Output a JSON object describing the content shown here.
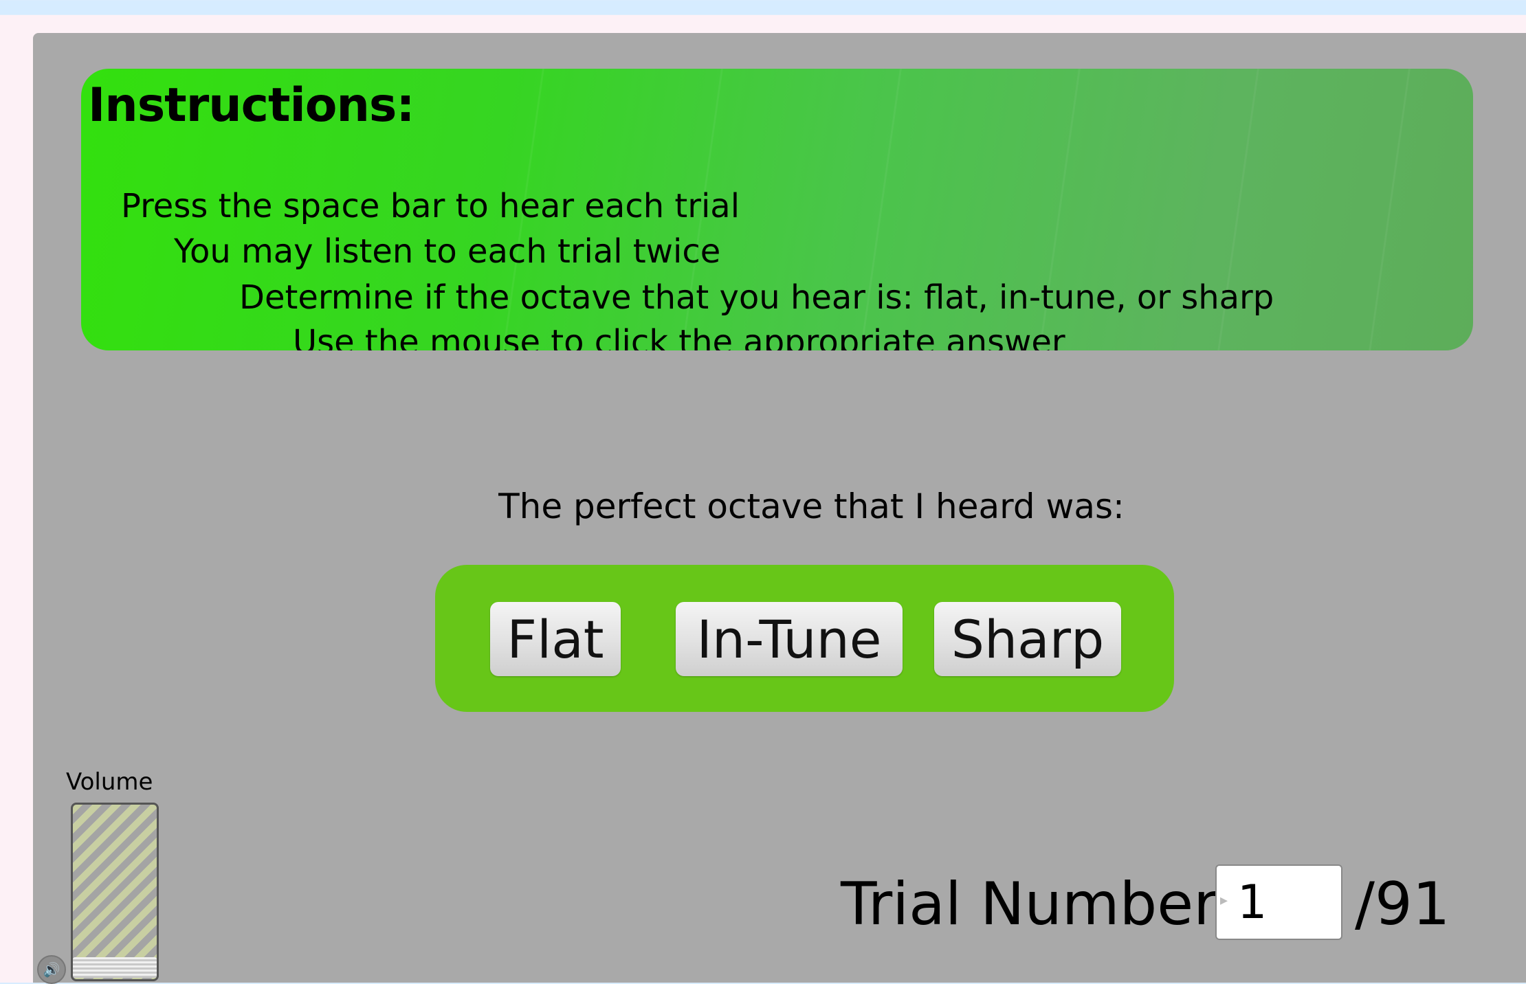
{
  "instructions": {
    "title": "Instructions:",
    "lines": [
      "Press the space bar to hear each trial",
      "You may listen to each trial twice",
      "Determine if the octave that you hear is: flat, in-tune, or sharp",
      "Use the mouse to click the appropriate answer"
    ]
  },
  "question": "The perfect octave that I heard was:",
  "answers": {
    "flat": "Flat",
    "in_tune": "In-Tune",
    "sharp": "Sharp"
  },
  "volume": {
    "label": "Volume",
    "level": 0.0,
    "speaker_icon": "speaker-icon"
  },
  "trial": {
    "label": "Trial Number",
    "current": "1",
    "total": "/91"
  },
  "colors": {
    "background": "#a9a9a9",
    "instructions_start": "#33e00e",
    "instructions_end": "#5dad5a",
    "answer_panel": "#67c618"
  }
}
